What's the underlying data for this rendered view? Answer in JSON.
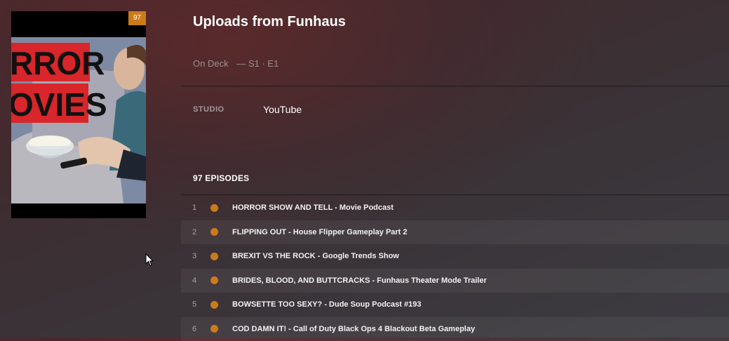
{
  "poster": {
    "badge": "97",
    "art_text_line1": "RROR",
    "art_text_line2": "OVIES"
  },
  "show": {
    "title": "Uploads from Funhaus",
    "on_deck_label": "On Deck",
    "on_deck_episode": "— S1 · E1",
    "studio_label": "STUDIO",
    "studio_value": "YouTube"
  },
  "episodes_header": "97 EPISODES",
  "episodes": [
    {
      "number": "1",
      "title": "HORROR SHOW AND TELL - Movie Podcast"
    },
    {
      "number": "2",
      "title": "FLIPPING OUT - House Flipper Gameplay Part 2"
    },
    {
      "number": "3",
      "title": "BREXIT VS THE ROCK - Google Trends Show"
    },
    {
      "number": "4",
      "title": "BRIDES, BLOOD, AND BUTTCRACKS - Funhaus Theater Mode Trailer"
    },
    {
      "number": "5",
      "title": "BOWSETTE TOO SEXY? - Dude Soup Podcast #193"
    },
    {
      "number": "6",
      "title": "COD DAMN IT! - Call of Duty Black Ops 4 Blackout Beta Gameplay"
    }
  ],
  "colors": {
    "accent": "#cc7b19",
    "unwatched_dot": "#cc7b19"
  }
}
